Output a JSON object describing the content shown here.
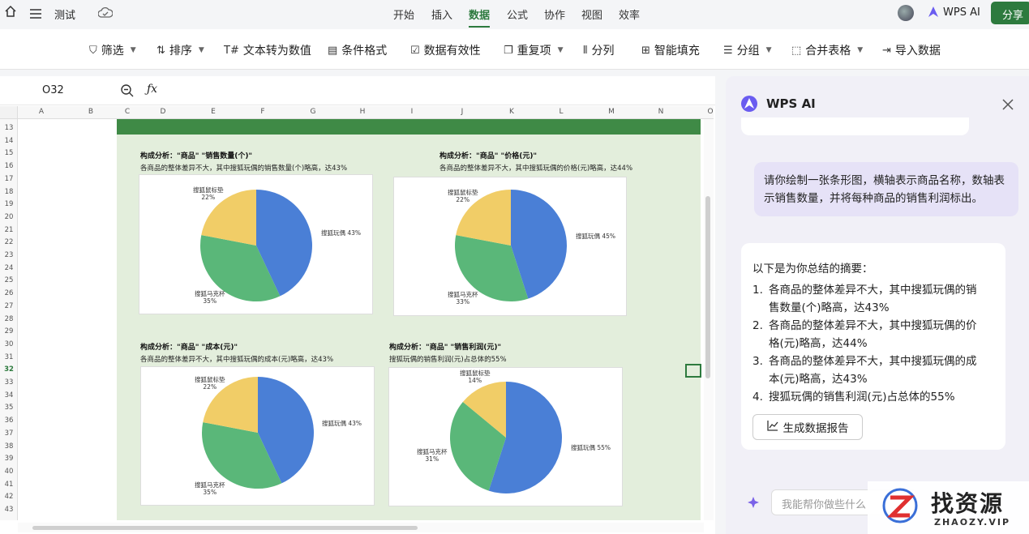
{
  "app": {
    "doc_title": "测试",
    "share_label": "分享",
    "wps_ai_label": "WPS AI"
  },
  "menu_tabs": [
    {
      "label": "开始",
      "active": false
    },
    {
      "label": "插入",
      "active": false
    },
    {
      "label": "数据",
      "active": true
    },
    {
      "label": "公式",
      "active": false
    },
    {
      "label": "协作",
      "active": false
    },
    {
      "label": "视图",
      "active": false
    },
    {
      "label": "效率",
      "active": false
    }
  ],
  "ribbon": {
    "filter": "筛选",
    "sort": "排序",
    "text_to_number": "文本转为数值",
    "conditional_format": "条件格式",
    "data_validation": "数据有效性",
    "duplicates": "重复项",
    "split_column": "分列",
    "smart_fill": "智能填充",
    "group": "分组",
    "merge_tables": "合并表格",
    "import_data": "导入数据"
  },
  "formula_bar": {
    "cell_ref": "O32",
    "fx": "ƒx"
  },
  "columns": [
    "A",
    "B",
    "C",
    "D",
    "E",
    "F",
    "G",
    "H",
    "I",
    "J",
    "K",
    "L",
    "M",
    "N",
    "O"
  ],
  "rows": [
    "13",
    "14",
    "15",
    "16",
    "17",
    "18",
    "19",
    "20",
    "21",
    "22",
    "23",
    "24",
    "25",
    "26",
    "27",
    "28",
    "29",
    "30",
    "31",
    "32",
    "33",
    "34",
    "35",
    "36",
    "37",
    "38",
    "39",
    "40",
    "41",
    "42",
    "43"
  ],
  "charts": [
    {
      "title": "构成分析：\"商品\" \"销售数量(个)\"",
      "subtitle": "各商品的整体差异不大，其中搜狐玩偶的销售数量(个)略高，达43%",
      "labels": [
        {
          "text": "搜狐玩偶 43%"
        },
        {
          "text": "搜狐马克杯",
          "pct": "35%"
        },
        {
          "text": "搜狐鼠标垫",
          "pct": "22%"
        }
      ]
    },
    {
      "title": "构成分析：\"商品\" \"价格(元)\"",
      "subtitle": "各商品的整体差异不大，其中搜狐玩偶的价格(元)略高，达44%",
      "labels": [
        {
          "text": "搜狐玩偶 45%"
        },
        {
          "text": "搜狐马克杯",
          "pct": "33%"
        },
        {
          "text": "搜狐鼠标垫",
          "pct": "22%"
        }
      ]
    },
    {
      "title": "构成分析：\"商品\" \"成本(元)\"",
      "subtitle": "各商品的整体差异不大，其中搜狐玩偶的成本(元)略高，达43%",
      "labels": [
        {
          "text": "搜狐玩偶 43%"
        },
        {
          "text": "搜狐马克杯",
          "pct": "35%"
        },
        {
          "text": "搜狐鼠标垫",
          "pct": "22%"
        }
      ]
    },
    {
      "title": "构成分析：\"商品\" \"销售利润(元)\"",
      "subtitle": "搜狐玩偶的销售利润(元)占总体的55%",
      "labels": [
        {
          "text": "搜狐玩偶 55%"
        },
        {
          "text": "搜狐马克杯",
          "pct": "31%"
        },
        {
          "text": "搜狐鼠标垫",
          "pct": "14%"
        }
      ]
    }
  ],
  "chart_data": [
    {
      "type": "pie",
      "categories": [
        "搜狐玩偶",
        "搜狐马克杯",
        "搜狐鼠标垫"
      ],
      "values": [
        43,
        35,
        22
      ],
      "title": "构成分析：\"商品\" \"销售数量(个)\""
    },
    {
      "type": "pie",
      "categories": [
        "搜狐玩偶",
        "搜狐马克杯",
        "搜狐鼠标垫"
      ],
      "values": [
        45,
        33,
        22
      ],
      "title": "构成分析：\"商品\" \"价格(元)\""
    },
    {
      "type": "pie",
      "categories": [
        "搜狐玩偶",
        "搜狐马克杯",
        "搜狐鼠标垫"
      ],
      "values": [
        43,
        35,
        22
      ],
      "title": "构成分析：\"商品\" \"成本(元)\""
    },
    {
      "type": "pie",
      "categories": [
        "搜狐玩偶",
        "搜狐马克杯",
        "搜狐鼠标垫"
      ],
      "values": [
        55,
        31,
        14
      ],
      "title": "构成分析：\"商品\" \"销售利润(元)\""
    }
  ],
  "colors": {
    "slice1": "#4a7fd6",
    "slice2": "#5ab779",
    "slice3": "#f1cd67",
    "accent": "#2d7a3e"
  },
  "ai_panel": {
    "title": "WPS AI",
    "user_message": "请你绘制一张条形图，横轴表示商品名称，数轴表示销售数量，并将每种商品的销售利润标出。",
    "summary_intro": "以下是为你总结的摘要：",
    "summary_items": [
      {
        "num": "1.",
        "line1": "各商品的整体差异不大，其中搜狐玩偶的销",
        "line2": "售数量(个)略高，达43%"
      },
      {
        "num": "2.",
        "line1": "各商品的整体差异不大，其中搜狐玩偶的价",
        "line2": "格(元)略高，达44%"
      },
      {
        "num": "3.",
        "line1": "各商品的整体差异不大，其中搜狐玩偶的成",
        "line2": "本(元)略高，达43%"
      },
      {
        "num": "4.",
        "line1": "搜狐玩偶的销售利润(元)占总体的55%",
        "line2": ""
      }
    ],
    "generate_report_label": "生成数据报告",
    "input_placeholder": "我能帮你做些什么"
  },
  "watermark": {
    "main": "找资源",
    "sub": "ZHAOZY.VIP"
  }
}
